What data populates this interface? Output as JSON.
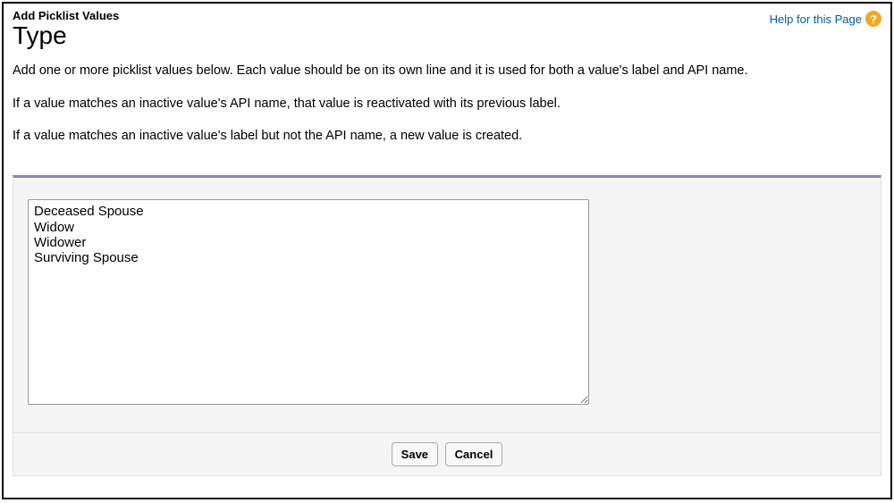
{
  "header": {
    "breadcrumb": "Add Picklist Values",
    "title": "Type",
    "help_link": "Help for this Page",
    "help_icon_label": "?"
  },
  "description": {
    "line1": "Add one or more picklist values below. Each value should be on its own line and it is used for both a value's label and API name.",
    "line2": "If a value matches an inactive value's API name, that value is reactivated with its previous label.",
    "line3": "If a value matches an inactive value's label but not the API name, a new value is created."
  },
  "form": {
    "textarea_value": "Deceased Spouse\nWidow\nWidower\nSurviving Spouse"
  },
  "buttons": {
    "save": "Save",
    "cancel": "Cancel"
  }
}
